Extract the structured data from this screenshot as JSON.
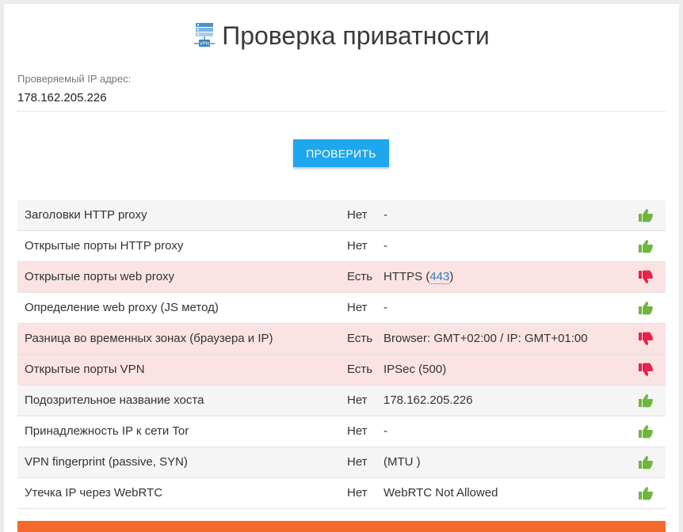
{
  "page": {
    "title": "Проверка приватности",
    "title_icon": "vpn-server-icon",
    "ip_label": "Проверяемый IP адрес:",
    "ip_value": "178.162.205.226",
    "check_button": "ПРОВЕРИТЬ"
  },
  "colors": {
    "accent_button": "#1ea7ee",
    "bad_row": "#fbe3e3",
    "thumb_up": "#6fb63e",
    "thumb_down": "#e8224a",
    "bottom_bar": "#f36a2c"
  },
  "results": [
    {
      "name": "Заголовки HTTP proxy",
      "status": "Нет",
      "detail": "-",
      "icon": "thumbs-up-icon"
    },
    {
      "name": "Открытые порты HTTP proxy",
      "status": "Нет",
      "detail": "-",
      "icon": "thumbs-up-icon"
    },
    {
      "name": "Открытые порты web proxy",
      "status": "Есть",
      "detail_prefix": "HTTPS (",
      "detail_link": "443",
      "detail_suffix": ")",
      "icon": "thumbs-down-icon"
    },
    {
      "name": "Определение web proxy (JS метод)",
      "status": "Нет",
      "detail": "-",
      "icon": "thumbs-up-icon"
    },
    {
      "name": "Разница во временных зонах (браузера и IP)",
      "status": "Есть",
      "detail": "Browser: GMT+02:00 / IP: GMT+01:00",
      "icon": "thumbs-down-icon"
    },
    {
      "name": "Открытые порты VPN",
      "status": "Есть",
      "detail": "IPSec (500)",
      "icon": "thumbs-down-icon"
    },
    {
      "name": "Подозрительное название хоста",
      "status": "Нет",
      "detail": "178.162.205.226",
      "icon": "thumbs-up-icon"
    },
    {
      "name": "Принадлежность IP к сети Tor",
      "status": "Нет",
      "detail": "-",
      "icon": "thumbs-up-icon"
    },
    {
      "name": "VPN fingerprint (passive, SYN)",
      "status": "Нет",
      "detail": "(MTU )",
      "icon": "thumbs-up-icon"
    },
    {
      "name": "Утечка IP через WebRTC",
      "status": "Нет",
      "detail": "WebRTC Not Allowed",
      "icon": "thumbs-up-icon"
    }
  ]
}
